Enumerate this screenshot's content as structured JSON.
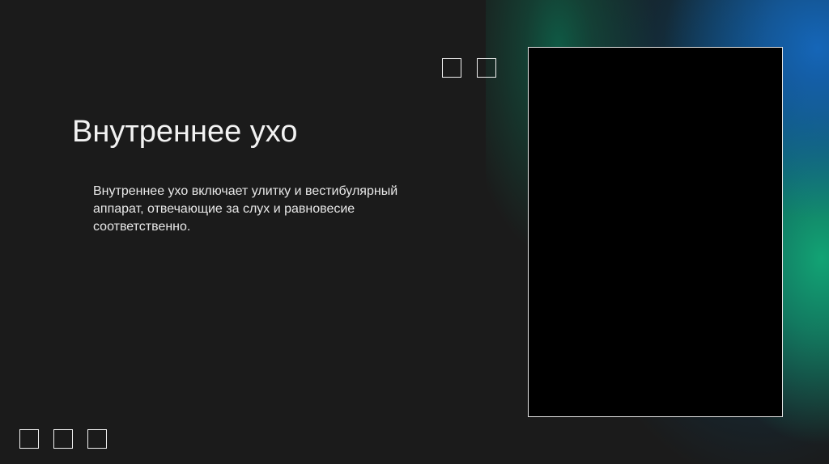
{
  "slide": {
    "title": "Внутреннее ухо",
    "body": "Внутреннее ухо включает улитку и вестибулярный аппарат, отвечающие за слух и равновесие соответственно."
  },
  "decorations": {
    "top_squares_count": 2,
    "bottom_squares_count": 3,
    "accent_colors": [
      "#1566b8",
      "#12a374",
      "#0f5a45"
    ],
    "background_color": "#1b1b1b"
  },
  "image_placeholder": {
    "icon": "image-frame-icon",
    "fill_color": "#000000"
  }
}
